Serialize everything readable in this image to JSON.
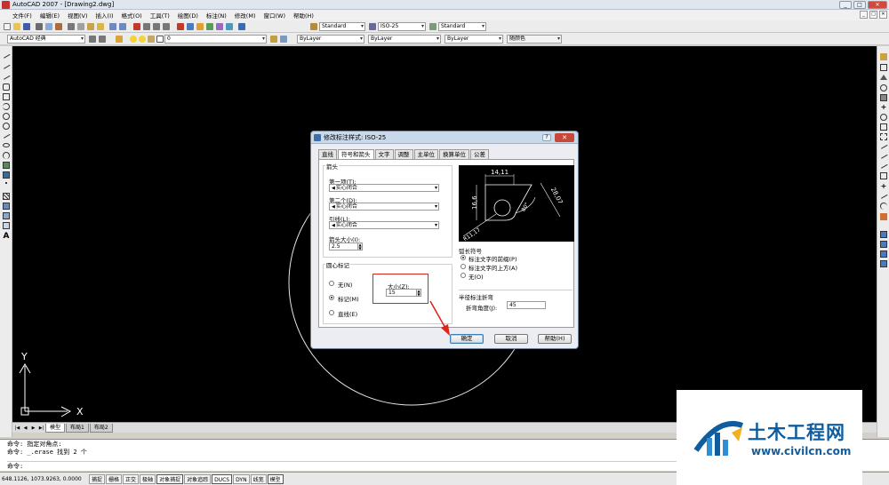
{
  "window": {
    "title": "AutoCAD 2007 - [Drawing2.dwg]",
    "controls": [
      "_",
      "□",
      "✕"
    ]
  },
  "menubar": {
    "items": [
      "文件(F)",
      "编辑(E)",
      "视图(V)",
      "插入(I)",
      "格式(O)",
      "工具(T)",
      "绘图(D)",
      "标注(N)",
      "修改(M)",
      "窗口(W)",
      "帮助(H)"
    ],
    "mdi_controls": [
      "_",
      "□",
      "✕"
    ]
  },
  "toolbar_standard": {
    "text_style": "Standard",
    "dim_style": "ISO-25",
    "table_style": "Standard"
  },
  "toolbar_layers": {
    "workspace": "AutoCAD 经典",
    "layer": "0",
    "color": "ByLayer",
    "linetype": "ByLayer",
    "lineweight": "ByLayer",
    "plot_style": "随颜色"
  },
  "layout_tabs": [
    "模型",
    "布局1",
    "布局2"
  ],
  "command": {
    "history": [
      "命令: 指定对角点:",
      "命令: _.erase 找到 2 个"
    ],
    "prompt": "命令:"
  },
  "status": {
    "coordinates": "648.1126,  1073.9263, 0.0000",
    "toggles": [
      {
        "label": "捕捉",
        "on": false
      },
      {
        "label": "栅格",
        "on": false
      },
      {
        "label": "正交",
        "on": false
      },
      {
        "label": "极轴",
        "on": false
      },
      {
        "label": "对象捕捉",
        "on": true
      },
      {
        "label": "对象追踪",
        "on": false
      },
      {
        "label": "DUCS",
        "on": true
      },
      {
        "label": "DYN",
        "on": false
      },
      {
        "label": "线宽",
        "on": false
      },
      {
        "label": "模型",
        "on": true
      }
    ]
  },
  "ucs": {
    "x": "X",
    "y": "Y"
  },
  "dialog": {
    "title": "修改标注样式: ISO-25",
    "tabs": [
      "直线",
      "符号和箭头",
      "文字",
      "调整",
      "主单位",
      "换算单位",
      "公差"
    ],
    "active_tab": 1,
    "arrowheads": {
      "legend": "箭头",
      "first_label": "第一项(T):",
      "first_value": "实心闭合",
      "second_label": "第二个(D):",
      "second_value": "实心闭合",
      "leader_label": "引线(L):",
      "leader_value": "实心闭合",
      "size_label": "箭头大小(I):",
      "size_value": "2.5"
    },
    "center_marks": {
      "legend": "圆心标记",
      "options": [
        {
          "label": "无(N)",
          "checked": false
        },
        {
          "label": "标记(M)",
          "checked": true
        },
        {
          "label": "直线(E)",
          "checked": false
        }
      ],
      "size_label": "大小(Z):",
      "size_value": "15"
    },
    "arc_length_symbol": {
      "legend": "弧长符号",
      "options": [
        {
          "label": "标注文字的前缀(P)",
          "checked": true
        },
        {
          "label": "标注文字的上方(A)",
          "checked": false
        },
        {
          "label": "无(O)",
          "checked": false
        }
      ]
    },
    "radius_jog": {
      "legend": "半径标注折弯",
      "angle_label": "折弯角度(J):",
      "angle_value": "45"
    },
    "preview_labels": [
      "14,11",
      "16,6",
      "28,07",
      "80°",
      "R11,17"
    ],
    "buttons": {
      "ok": "确定",
      "cancel": "取消",
      "help": "帮助(H)"
    }
  },
  "watermark": {
    "brand": "土木工程网",
    "site": "www.civilcn.com"
  },
  "colors": {
    "canvas": "#000000",
    "highlight": "#d8261c",
    "brand": "#0f5d9e"
  }
}
